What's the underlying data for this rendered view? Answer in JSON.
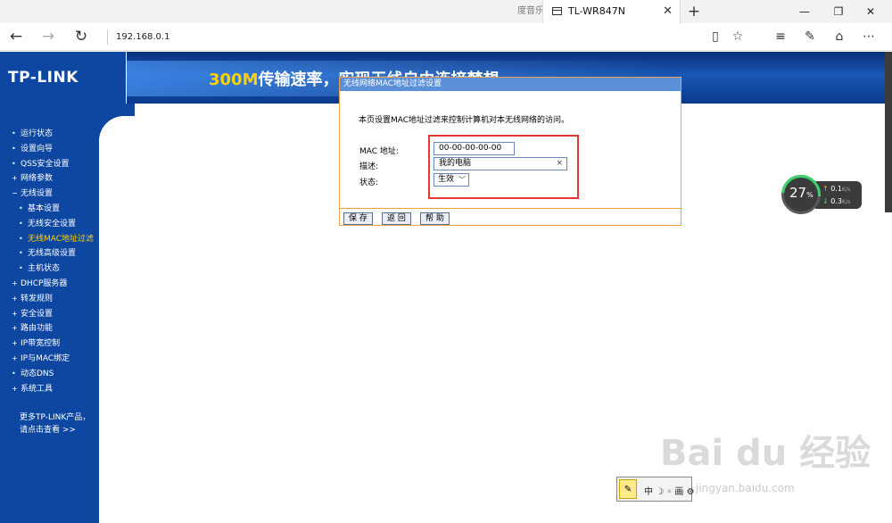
{
  "browser": {
    "prev_tab_label": "度音乐",
    "active_tab_title": "TL-WR847N",
    "close_glyph": "✕",
    "new_tab_glyph": "+",
    "address": "192.168.0.1",
    "window_controls": [
      "—",
      "❐",
      "✕"
    ]
  },
  "banner": {
    "logo": "TP-LINK",
    "slogan_highlight": "300M",
    "slogan_rest": "传输速率，实现无线自由连接梦想"
  },
  "sidebar": {
    "items": [
      {
        "label": "运行状态",
        "sub": false,
        "active": false,
        "bullet": "•"
      },
      {
        "label": "设置向导",
        "sub": false,
        "active": false,
        "bullet": "•"
      },
      {
        "label": "QSS安全设置",
        "sub": false,
        "active": false,
        "bullet": "•"
      },
      {
        "label": "网络参数",
        "sub": false,
        "active": false,
        "bullet": "+"
      },
      {
        "label": "无线设置",
        "sub": false,
        "active": false,
        "bullet": "−"
      },
      {
        "label": "基本设置",
        "sub": true,
        "active": false,
        "bullet": "•"
      },
      {
        "label": "无线安全设置",
        "sub": true,
        "active": false,
        "bullet": "•"
      },
      {
        "label": "无线MAC地址过滤",
        "sub": true,
        "active": true,
        "bullet": "•"
      },
      {
        "label": "无线高级设置",
        "sub": true,
        "active": false,
        "bullet": "•"
      },
      {
        "label": "主机状态",
        "sub": true,
        "active": false,
        "bullet": "•"
      },
      {
        "label": "DHCP服务器",
        "sub": false,
        "active": false,
        "bullet": "+"
      },
      {
        "label": "转发规则",
        "sub": false,
        "active": false,
        "bullet": "+"
      },
      {
        "label": "安全设置",
        "sub": false,
        "active": false,
        "bullet": "+"
      },
      {
        "label": "路由功能",
        "sub": false,
        "active": false,
        "bullet": "+"
      },
      {
        "label": "IP带宽控制",
        "sub": false,
        "active": false,
        "bullet": "+"
      },
      {
        "label": "IP与MAC绑定",
        "sub": false,
        "active": false,
        "bullet": "+"
      },
      {
        "label": "动态DNS",
        "sub": false,
        "active": false,
        "bullet": "•"
      },
      {
        "label": "系统工具",
        "sub": false,
        "active": false,
        "bullet": "+"
      }
    ],
    "more_line1": "更多TP-LINK产品，",
    "more_line2": "请点击查看 >>"
  },
  "form": {
    "title": "无线网络MAC地址过滤设置",
    "description": "本页设置MAC地址过滤来控制计算机对本无线网络的访问。",
    "mac_label": "MAC 地址:",
    "mac_value": "00-00-00-00-00",
    "desc_label": "描述:",
    "desc_value": "我的电脑",
    "status_label": "状态:",
    "status_value": "生效",
    "buttons": {
      "save": "保 存",
      "back": "返 回",
      "help": "帮 助"
    }
  },
  "speed_widget": {
    "percent": "27",
    "percent_sign": "%",
    "up": "0.1",
    "down": "0.3",
    "unit": "K/s"
  },
  "ime": {
    "text": "中 ☽ ◦ 画 ⚙"
  },
  "watermark": {
    "text": "Bai du 经验",
    "url": "jingyan.baidu.com"
  },
  "colors": {
    "brand_blue": "#0d47a1",
    "panel_header": "#5b8fd8",
    "panel_border": "#f0a24a",
    "highlight_box": "#e53935",
    "active_menu": "#ffd200"
  }
}
